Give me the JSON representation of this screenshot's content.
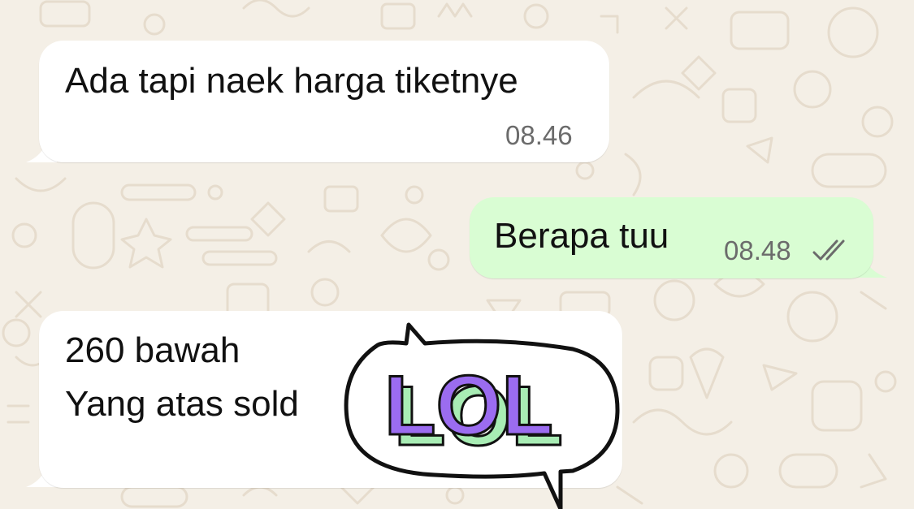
{
  "chat": {
    "messages": [
      {
        "direction": "incoming",
        "text": "Ada tapi naek harga tiketnye",
        "time": "08.46"
      },
      {
        "direction": "outgoing",
        "text": "Berapa tuu",
        "time": "08.48",
        "status_icon": "double-check-icon"
      },
      {
        "direction": "incoming",
        "lines": [
          "260 bawah",
          "Yang atas sold"
        ],
        "sticker": {
          "text": "LOL",
          "icon": "lol-sticker"
        }
      }
    ]
  },
  "colors": {
    "wallpaper": "#F4EFE6",
    "incoming_bubble": "#FFFFFF",
    "outgoing_bubble": "#D9FDD3",
    "sticker_letter": "#9B6CF0",
    "sticker_side": "#A8ECB4"
  }
}
